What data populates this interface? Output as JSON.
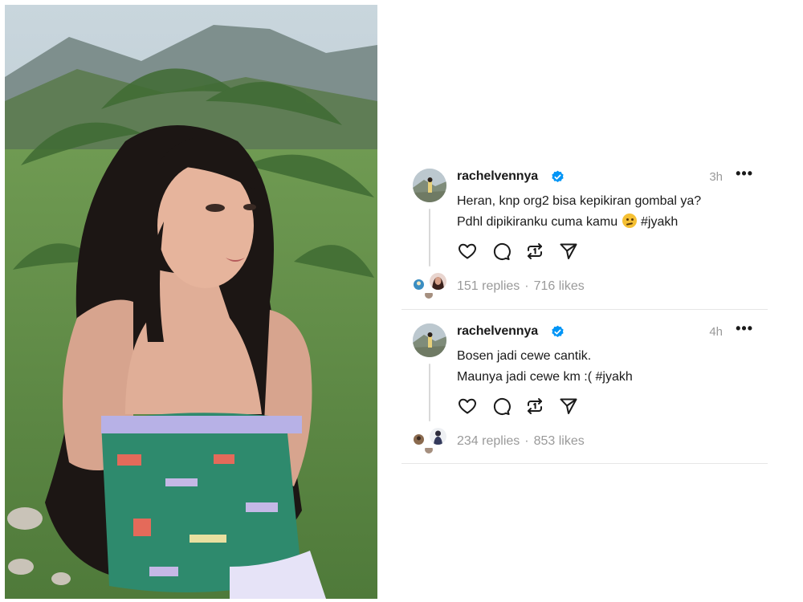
{
  "posts": [
    {
      "username": "rachelvennyа",
      "verified": true,
      "time": "3h",
      "more": "•••",
      "lines": [
        "Heran, knp org2 bisa kepikiran gombal ya?",
        "Pdhl dipikiranku cuma kamu",
        "#jyakh"
      ],
      "emoji": "face-with-raised-eyebrow-emoji",
      "replies": "151 replies",
      "likes": "716 likes",
      "separator": "·"
    },
    {
      "username": "rachelvennyа",
      "verified": true,
      "time": "4h",
      "more": "•••",
      "lines": [
        "Bosen jadi cewe cantik.",
        "Maunya jadi cewe km :( #jyakh"
      ],
      "replies": "234 replies",
      "likes": "853 likes",
      "separator": "·"
    }
  ],
  "icons": {
    "like": "heart-icon",
    "comment": "comment-bubble-icon",
    "repost": "repost-icon",
    "share": "send-icon",
    "verified": "verified-badge-icon"
  },
  "colors": {
    "verified_blue": "#0095f6",
    "text": "#1a1a1a",
    "secondary": "#9a9a9a"
  }
}
